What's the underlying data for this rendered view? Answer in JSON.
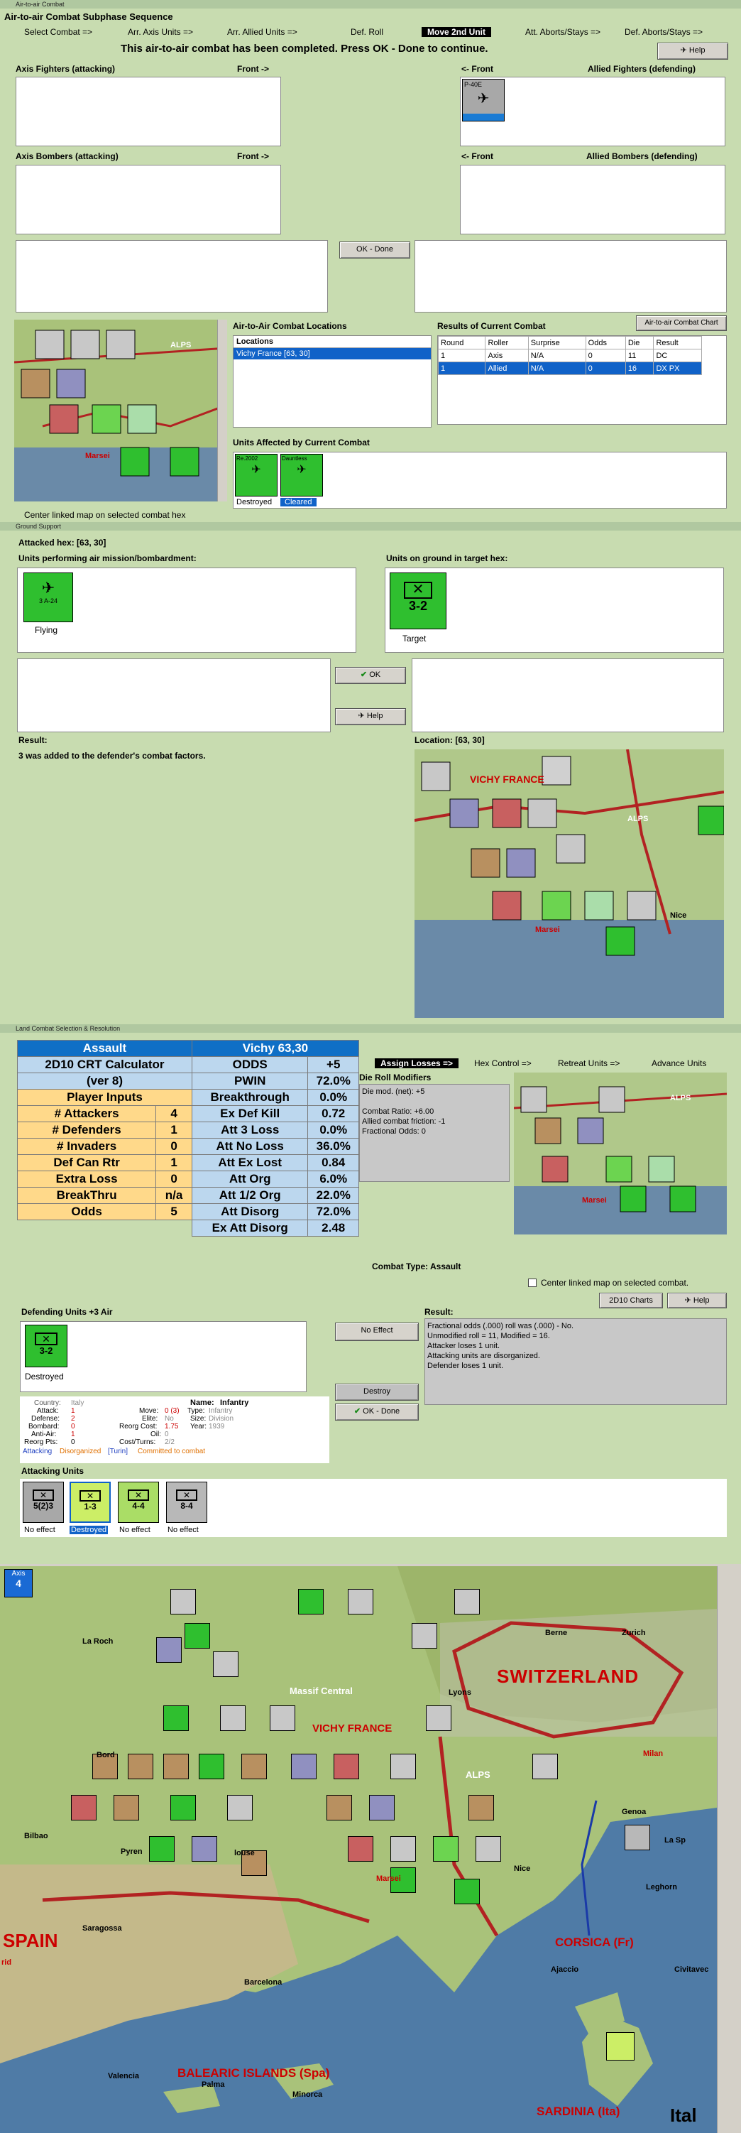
{
  "air_window": {
    "title": "Air-to-air Combat",
    "subphase_title": "Air-to-air Combat Subphase Sequence",
    "help_label": "Help",
    "steps": [
      "Select Combat =>",
      "Arr. Axis Units =>",
      "Arr. Allied Units =>",
      "Def. Roll",
      "Move 2nd Unit",
      "Att. Aborts/Stays =>",
      "Def. Aborts/Stays =>"
    ],
    "message": "This air-to-air combat has been completed.  Press OK - Done to continue.",
    "axis_fighters_label": "Axis Fighters (attacking)",
    "front_right": "Front ->",
    "front_left": "<- Front",
    "allied_fighters_label": "Allied Fighters (defending)",
    "axis_bombers_label": "Axis Bombers (attacking)",
    "allied_bombers_label": "Allied Bombers (defending)",
    "ok_done": "OK - Done",
    "locations_title": "Air-to-Air Combat Locations",
    "locations_header": "Locations",
    "locations": [
      "Vichy France [63, 30]"
    ],
    "results_title": "Results of Current Combat",
    "chart_button": "Air-to-air Combat Chart",
    "results_headers": [
      "Round",
      "Roller",
      "Surprise",
      "Odds",
      "Die",
      "Result"
    ],
    "results_rows": [
      [
        "1",
        "Axis",
        "N/A",
        "0",
        "11",
        "DC"
      ],
      [
        "1",
        "Allied",
        "N/A",
        "0",
        "16",
        "DX PX"
      ]
    ],
    "affected_title": "Units Affected by Current Combat",
    "affected": [
      {
        "name": "Re.2002",
        "status": "Destroyed"
      },
      {
        "name": "Dauntless",
        "status": "Cleared"
      }
    ],
    "center_map": "Center linked map on selected combat hex",
    "allied_counter": "P-40E"
  },
  "ground_window": {
    "title": "Ground Support",
    "attacked_hex": "Attacked hex: [63, 30]",
    "air_units_label": "Units performing air mission/bombardment:",
    "ground_units_label": "Units on ground in target hex:",
    "air_unit": {
      "name": "Dauntless",
      "status": "Flying",
      "values": "3  A-24"
    },
    "ground_unit": {
      "value": "3-2",
      "status": "Target"
    },
    "ok": "OK",
    "help": "Help",
    "result_label": "Result:",
    "result_text": "3 was added to the defender's combat factors.",
    "location_label": "Location:  [63, 30]"
  },
  "land_window": {
    "title": "Land Combat Selection & Resolution",
    "calc": {
      "title_left": "Assault",
      "title_right": "Vichy 63,30",
      "rows": [
        [
          "2D10 CRT Calculator",
          "ODDS",
          "+5"
        ],
        [
          "(ver 8)",
          "PWIN",
          "72.0%"
        ],
        [
          "Player Inputs",
          "Breakthrough",
          "0.0%"
        ],
        [
          "# Attackers",
          "4",
          "Ex Def Kill",
          "0.72"
        ],
        [
          "# Defenders",
          "1",
          "Att 3 Loss",
          "0.0%"
        ],
        [
          "# Invaders",
          "0",
          "Att No Loss",
          "36.0%"
        ],
        [
          "Def Can Rtr",
          "1",
          "Att Ex Lost",
          "0.84"
        ],
        [
          "Extra Loss",
          "0",
          "Att Org",
          "6.0%"
        ],
        [
          "BreakThru",
          "n/a",
          "Att 1/2 Org",
          "22.0%"
        ],
        [
          "Odds",
          "5",
          "Att Disorg",
          "72.0%"
        ],
        [
          "",
          "",
          "Ex Att Disorg",
          "2.48"
        ]
      ]
    },
    "steps": [
      "Assign Losses =>",
      "Hex Control =>",
      "Retreat Units =>",
      "Advance Units"
    ],
    "die_mods_title": "Die Roll Modifiers",
    "die_mods": [
      "Die mod. (net): +5",
      "",
      "Combat Ratio: +6.00",
      "Allied combat friction: -1",
      "Fractional Odds: 0"
    ],
    "combat_type": "Combat Type:  Assault",
    "center_map": "Center linked map on selected combat.",
    "charts_button": "2D10 Charts",
    "help": "Help",
    "defending_label": "Defending Units +3 Air",
    "defender": {
      "value": "3-2",
      "status": "Destroyed"
    },
    "no_effect_button": "No Effect",
    "destroy_button": "Destroy",
    "ok_done": "OK - Done",
    "result_label": "Result:",
    "result_lines": [
      "Fractional odds (.000) roll was (.000)  - No.",
      "Unmodified roll = 11, Modified = 16.",
      "Attacker loses 1 unit.",
      "Attacking units are disorganized.",
      "Defender loses 1 unit."
    ],
    "unit_info": {
      "country": "Country:",
      "country_v": "Italy",
      "attack": "Attack:",
      "attack_v": "1",
      "defense": "Defense:",
      "defense_v": "2",
      "bombard": "Bombard:",
      "bombard_v": "0",
      "antiair": "Anti-Air:",
      "antiair_v": "1",
      "reorg": "Reorg Pts:",
      "reorg_v": "0",
      "name": "Name:",
      "name_v": "Infantry",
      "move": "Move:",
      "move_v": "0 (3)",
      "elite": "Elite:",
      "elite_v": "No",
      "reorg_cost": "Reorg Cost:",
      "reorg_cost_v": "1.75",
      "oil": "Oil:",
      "oil_v": "0",
      "cost_turns": "Cost/Turns:",
      "cost_turns_v": "2/2",
      "type": "Type:",
      "type_v": "Infantry",
      "size": "Size:",
      "size_v": "Division",
      "year": "Year:",
      "year_v": "1939",
      "status_line_a": "Attacking",
      "status_line_b": "Disorganized",
      "status_line_c": "[Turin]",
      "status_line_d": "Committed to combat"
    },
    "attacking_label": "Attacking Units",
    "attackers": [
      {
        "value": "5(2)3",
        "status": "No effect"
      },
      {
        "value": "1-3",
        "status": "Destroyed"
      },
      {
        "value": "4-4",
        "status": "No effect"
      },
      {
        "value": "8-4",
        "status": "No effect"
      }
    ]
  },
  "main_map": {
    "axis_badge": "Axis",
    "turn_badge": "4",
    "labels": [
      "SWITZERLAND",
      "SPAIN",
      "CORSICA (Fr)",
      "BALEARIC ISLANDS (Spa)",
      "SARDINIA (Ita)",
      "VICHY FRANCE",
      "Massif Central",
      "ALPS",
      "Ital"
    ],
    "cities": [
      "La Roch",
      "Bord",
      "Bilbao",
      "Saragossa",
      "Barcelona",
      "Valencia",
      "Palma",
      "Minorca",
      "Lyons",
      "Berne",
      "Zurich",
      "Milan",
      "Genoa",
      "La Sp",
      "Leghorn",
      "Ajaccio",
      "Civitavec",
      "Marsei",
      "Nice",
      "Pyren",
      "louse",
      "rid"
    ]
  },
  "colors": {
    "window_bg": "#c8dcb0",
    "axis_green": "#2fbf2f",
    "allied_gray": "#a0a0a0",
    "header_blue": "#0f6fc6",
    "selection_blue": "#1062c8"
  }
}
